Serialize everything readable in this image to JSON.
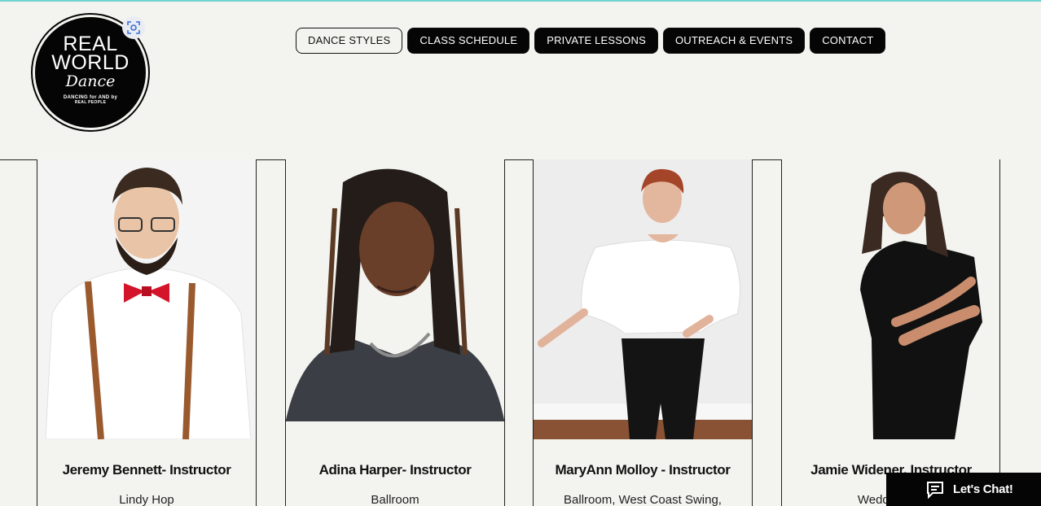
{
  "logo": {
    "line1": "REAL",
    "line2": "WORLD",
    "line3": "Dance",
    "line4": "DANCING for AND by",
    "line5": "REAL PEOPLE"
  },
  "nav": {
    "items": [
      {
        "label": "DANCE STYLES",
        "active": true
      },
      {
        "label": "CLASS SCHEDULE",
        "active": false
      },
      {
        "label": "PRIVATE LESSONS",
        "active": false
      },
      {
        "label": "OUTREACH & EVENTS",
        "active": false
      },
      {
        "label": "CONTACT",
        "active": false
      }
    ]
  },
  "instructors": [
    {
      "name": "Jeremy Bennett- Instructor",
      "styles": "Lindy Hop"
    },
    {
      "name": "Adina Harper- Instructor",
      "styles": "Ballroom"
    },
    {
      "name": "MaryAnn Molloy - Instructor",
      "styles": "Ballroom, West Coast Swing,"
    },
    {
      "name": "Jamie Widener, Instructor",
      "styles": "Wedding Co"
    }
  ],
  "chat": {
    "label": "Let's Chat!"
  },
  "colors": {
    "accent_top": "#6fd3d0",
    "background": "#f3f3ef",
    "button": "#050505"
  }
}
